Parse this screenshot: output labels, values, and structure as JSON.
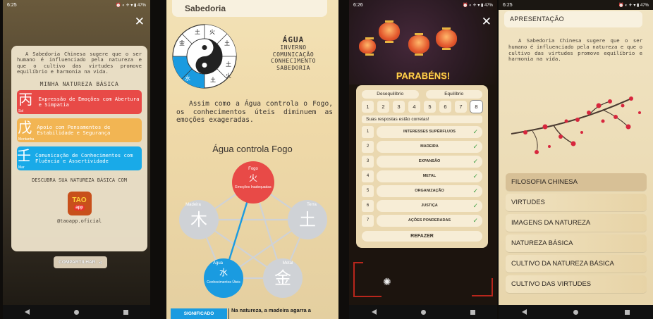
{
  "p1": {
    "status_time": "6:25",
    "status_right": "⏰ ◐ ✈ ▾ ▮ 47%",
    "intro": "A Sabedoria Chinesa sugere que o ser humano é influenciado pela natureza e que o cultivo das virtudes promove equilíbrio e harmonia na vida.",
    "section_title": "MINHA NATUREZA BÁSICA",
    "natures": [
      {
        "glyph": "丙",
        "name": "Sol",
        "text": "Expressão de Emoções com Abertura e Simpatia"
      },
      {
        "glyph": "戊",
        "name": "Montanha",
        "text": "Apoio com Pensamentos de Estabilidade e Segurança"
      },
      {
        "glyph": "壬",
        "name": "Mar",
        "text": "Comunicação de Conhecimentos com Fluência e Assertividade"
      }
    ],
    "discover": "DESCUBRA SUA NATUREZA BÁSICA COM",
    "logo_top": "TAO",
    "logo_bottom": "app",
    "handle": "@taoapp.oficial",
    "share": "COMPARTILHAR",
    "colors": {
      "sol": "#e84a47",
      "montanha": "#f2b553",
      "mar": "#19aae8"
    }
  },
  "p2": {
    "header": "Sabedoria",
    "element": "ÁGUA",
    "attributes": [
      "INVERNO",
      "COMUNICAÇÃO",
      "CONHECIMENTO",
      "SABEDORIA"
    ],
    "wheel_glyphs": [
      "火",
      "土",
      "土",
      "金",
      "土",
      "水",
      "土",
      "火"
    ],
    "quote": "Assim como a Água controla o Fogo, os conhecimentos úteis diminuem as emoções exageradas.",
    "control_title": "Água controla Fogo",
    "nodes": {
      "fogo": {
        "name": "Fogo",
        "glyph": "火",
        "desc": "Emoções Inadequadas"
      },
      "madeira": {
        "name": "Madeira",
        "glyph": "木"
      },
      "terra": {
        "name": "Terra",
        "glyph": "土"
      },
      "agua": {
        "name": "Água",
        "glyph": "水",
        "desc": "Conhecimentos Úteis"
      },
      "metal": {
        "name": "Metal",
        "glyph": "金"
      }
    },
    "meaning_button": "SIGNIFICADO",
    "meaning_text": "Na natureza, a madeira agarra a"
  },
  "p3": {
    "status_time": "6:26",
    "status_right": "⏰ ◐ ✈ ▾ ▮ 47%",
    "congrats": "PARABÉNS!",
    "label_left": "Desequilíbrio",
    "label_right": "Equilíbrio",
    "numbers": [
      "1",
      "2",
      "3",
      "4",
      "5",
      "6",
      "7",
      "8"
    ],
    "correct_msg": "Suas respostas estão corretas!",
    "answers": [
      {
        "n": "1",
        "t": "INTERESSES SUPÉRFLUOS"
      },
      {
        "n": "2",
        "t": "MADEIRA"
      },
      {
        "n": "3",
        "t": "EXPANSÃO"
      },
      {
        "n": "4",
        "t": "METAL"
      },
      {
        "n": "5",
        "t": "ORGANIZAÇÃO"
      },
      {
        "n": "6",
        "t": "JUSTIÇA"
      },
      {
        "n": "7",
        "t": "AÇÕES PONDERADAS"
      }
    ],
    "redo": "REFAZER"
  },
  "p4": {
    "status_time": "6:25",
    "status_right": "⏰ ◐ ✈ ▾ ▮ 47%",
    "header": "APRESENTAÇÃO",
    "intro": "A Sabedoria Chinesa sugere que o ser humano é influenciado pela natureza e que o cultivo das virtudes promove equilíbrio e harmonia na vida.",
    "menu": [
      "FILOSOFIA CHINESA",
      "VIRTUDES",
      "IMAGENS DA NATUREZA",
      "NATUREZA BÁSICA",
      "CULTIVO DA NATUREZA BÁSICA",
      "CULTIVO DAS VIRTUDES"
    ]
  }
}
